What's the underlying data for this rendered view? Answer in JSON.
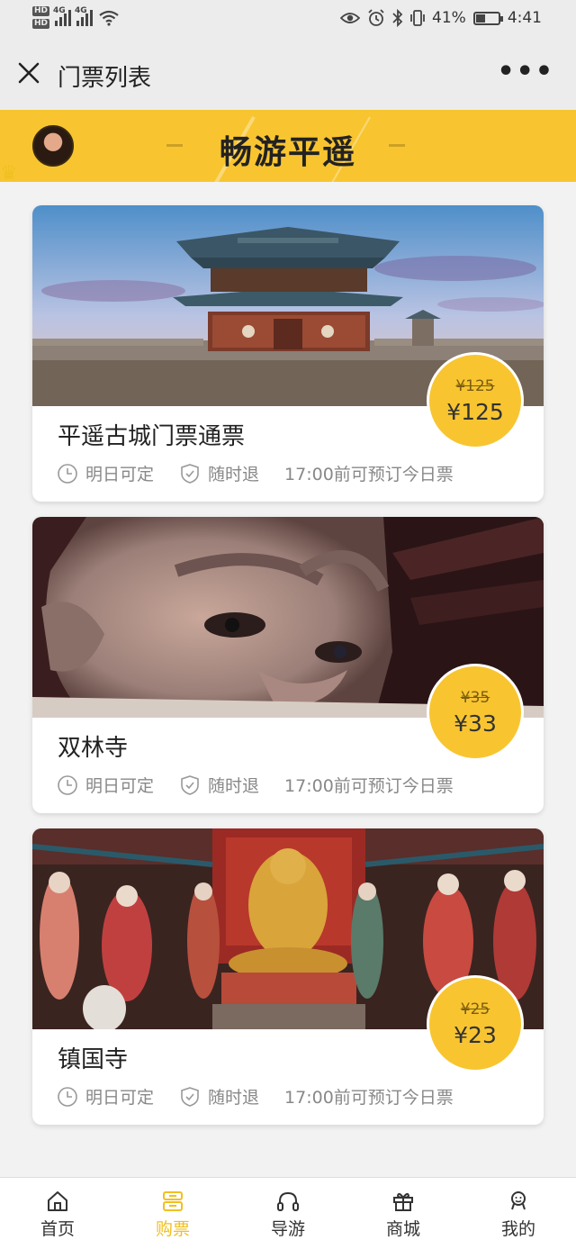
{
  "status_bar": {
    "hd1": "HD",
    "hd2": "HD",
    "net1": "4G",
    "net2": "4G",
    "battery_percent": "41%",
    "time": "4:41",
    "battery_level": 0.41
  },
  "nav": {
    "close_icon": "close-icon",
    "title": "门票列表",
    "more_label": "•••"
  },
  "banner": {
    "title": "畅游平遥",
    "accent_color": "#f8c531"
  },
  "tickets": [
    {
      "name": "平遥古城门票通票",
      "original_price": "¥125",
      "price": "¥125",
      "feature1": "明日可定",
      "feature2": "随时退",
      "feature3": "17:00前可预订今日票"
    },
    {
      "name": "双林寺",
      "original_price": "¥35",
      "price": "¥33",
      "feature1": "明日可定",
      "feature2": "随时退",
      "feature3": "17:00前可预订今日票"
    },
    {
      "name": "镇国寺",
      "original_price": "¥25",
      "price": "¥23",
      "feature1": "明日可定",
      "feature2": "随时退",
      "feature3": "17:00前可预订今日票"
    }
  ],
  "tabs": [
    {
      "label": "首页",
      "icon": "home-icon",
      "active": false
    },
    {
      "label": "购票",
      "icon": "ticket-icon",
      "active": true
    },
    {
      "label": "导游",
      "icon": "headphones-icon",
      "active": false
    },
    {
      "label": "商城",
      "icon": "gift-icon",
      "active": false
    },
    {
      "label": "我的",
      "icon": "user-icon",
      "active": false
    }
  ]
}
